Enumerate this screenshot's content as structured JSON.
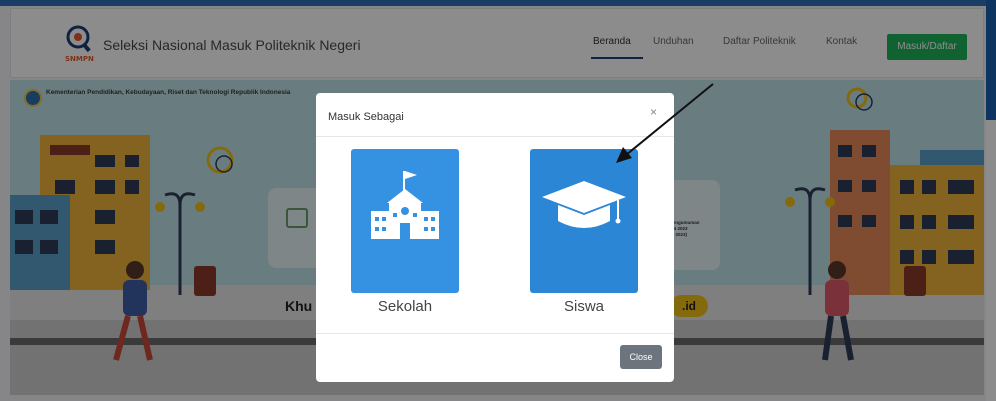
{
  "header": {
    "site_title": "Seleksi Nasional Masuk Politeknik Negeri",
    "logo_text": "SNMPN",
    "nav": [
      {
        "label": "Beranda"
      },
      {
        "label": "Unduhan"
      },
      {
        "label": "Daftar Politeknik"
      },
      {
        "label": "Kontak"
      }
    ],
    "login_label": "Masuk/Daftar"
  },
  "hero": {
    "ministry_text": "Kementerian Pendidikan, Kebudayaan, Riset dan Teknologi Republik Indonesia",
    "banner_fragment": "Khu",
    "domain_fragment": ".id",
    "calendar_text": [
      "pengumuman",
      "PN 2023",
      "ril 2023)"
    ]
  },
  "modal": {
    "title": "Masuk Sebagai",
    "close_x": "×",
    "options": [
      {
        "label": "Sekolah",
        "icon": "school-building-icon"
      },
      {
        "label": "Siswa",
        "icon": "graduation-cap-icon"
      }
    ],
    "close_label": "Close"
  },
  "colors": {
    "nav_active_underline": "#1f3f77",
    "login_button": "#1fb35a",
    "card_blue": "#2f8ee3",
    "close_button": "#6c757d"
  }
}
